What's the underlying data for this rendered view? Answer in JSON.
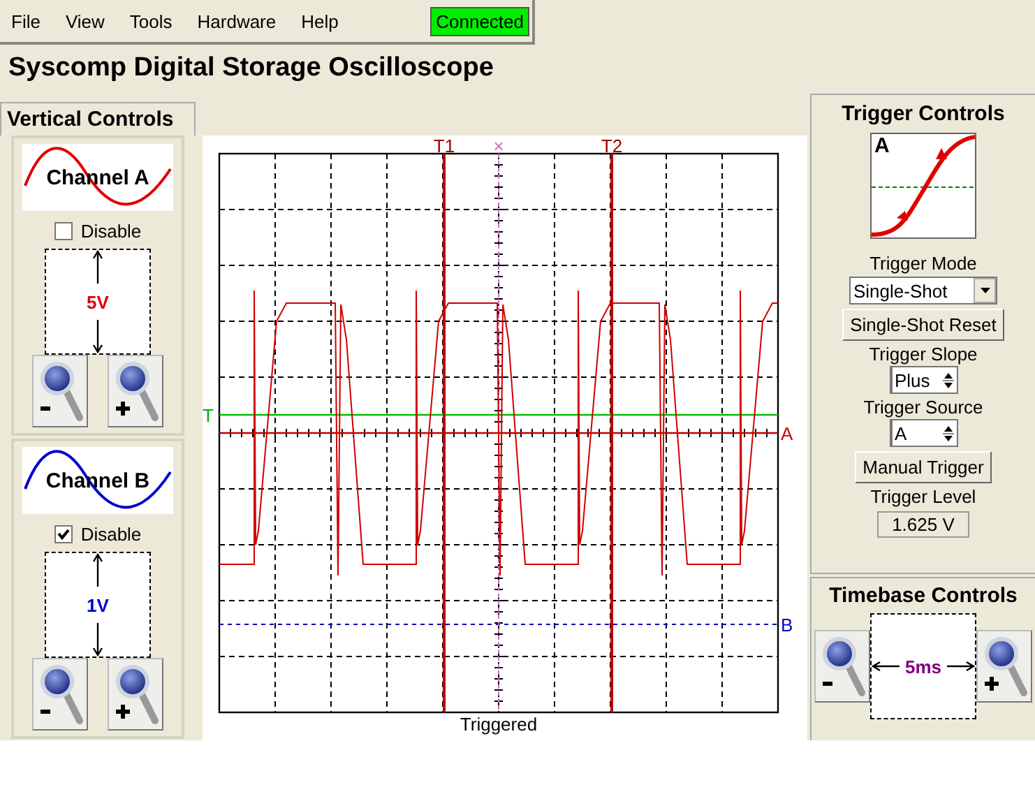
{
  "menu": [
    {
      "label": "File"
    },
    {
      "label": "View"
    },
    {
      "label": "Tools"
    },
    {
      "label": "Hardware"
    },
    {
      "label": "Help"
    }
  ],
  "status": {
    "label": "Connected",
    "connected": true
  },
  "title": "Syscomp Digital Storage Oscilloscope",
  "vertical_controls": {
    "title": "Vertical Controls",
    "channels": [
      {
        "name": "Channel A",
        "color": "#e00000",
        "disable": {
          "label": "Disable",
          "checked": false
        },
        "scale": "5V"
      },
      {
        "name": "Channel B",
        "color": "#0000d0",
        "disable": {
          "label": "Disable",
          "checked": true
        },
        "scale": "1V"
      }
    ]
  },
  "scope": {
    "cursors": [
      {
        "label": "T1"
      },
      {
        "label": "×"
      },
      {
        "label": "T2"
      }
    ],
    "trigger_label": "T",
    "channel_labels": [
      {
        "label": "A"
      },
      {
        "label": "B"
      }
    ],
    "status": "Triggered"
  },
  "trigger_controls": {
    "title": "Trigger Controls",
    "diagram_label": "A",
    "mode": {
      "label": "Trigger Mode",
      "value": "Single-Shot"
    },
    "reset_button": "Single-Shot Reset",
    "slope": {
      "label": "Trigger Slope",
      "value": "Plus"
    },
    "source": {
      "label": "Trigger Source",
      "value": "A"
    },
    "manual_button": "Manual Trigger",
    "level": {
      "label": "Trigger Level",
      "value": "1.625 V"
    }
  },
  "timebase_controls": {
    "title": "Timebase Controls",
    "scale": "5ms"
  }
}
